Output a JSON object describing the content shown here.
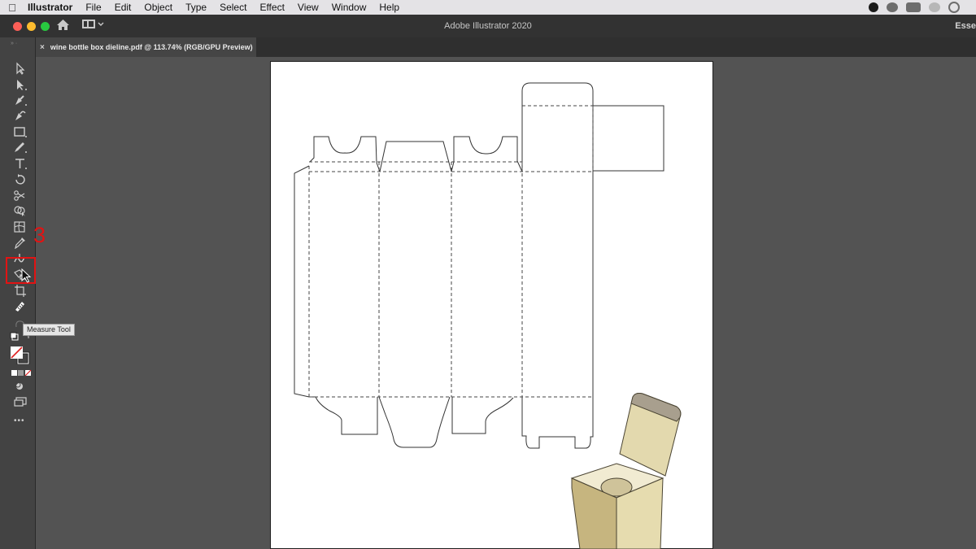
{
  "menubar": {
    "app_name": "Illustrator",
    "items": [
      "File",
      "Edit",
      "Object",
      "Type",
      "Select",
      "Effect",
      "View",
      "Window",
      "Help"
    ]
  },
  "titlebar": {
    "title": "Adobe Illustrator 2020",
    "workspace": "Esse"
  },
  "document_tab": {
    "label": "wine bottle box dieline.pdf @ 113.74% (RGB/GPU Preview)",
    "close_glyph": "×"
  },
  "annotation": {
    "step_number": "3",
    "highlight_color": "#e21313"
  },
  "tooltip": {
    "text": "Measure Tool"
  },
  "colors": {
    "ui_dark": "#323232",
    "panel": "#434343",
    "canvas": "#535353",
    "box_light": "#e3d9ae",
    "box_mid": "#c7b782",
    "box_dark": "#a89f8e"
  },
  "toolbar": {
    "more_glyph": "•••"
  }
}
